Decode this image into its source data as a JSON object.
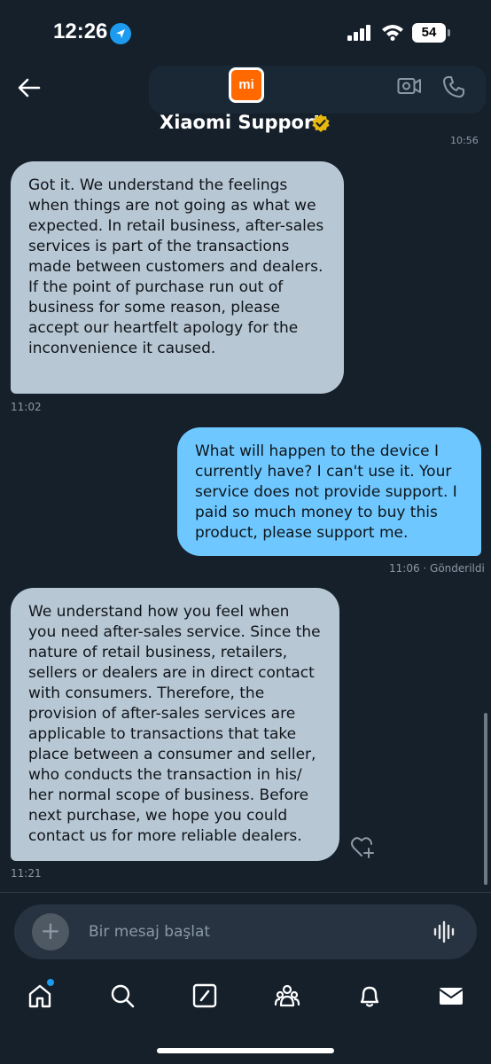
{
  "status_bar": {
    "time": "12:26",
    "battery": "54",
    "icons": [
      "location-icon",
      "signal-icon",
      "wifi-icon",
      "battery-icon"
    ]
  },
  "header": {
    "title": "Xiaomi Support",
    "avatar_text": "mi",
    "icons": [
      "back-arrow-icon",
      "verified-badge-icon",
      "video-call-icon",
      "phone-icon"
    ],
    "colors": {
      "avatar_bg": "#ff6900",
      "verified": "#e8b80c"
    }
  },
  "messages": [
    {
      "direction": "received",
      "text": "Got it. We understand the feelings when things are not going as what we expected. In retail business, after-sales services is part of the transactions made between customers and dealers. If the point of purchase run out of business for some reason, please accept our heartfelt apology for the inconvenience it caused.",
      "time": "11:02"
    },
    {
      "direction": "sent",
      "text": "What will happen to the device I currently have? I can't use it. Your service does not provide support. I paid so much money to buy this product, please support me.",
      "time": "11:06 · Gönderildi"
    },
    {
      "direction": "received",
      "text": "We understand how you feel when you need after-sales service. Since the nature of retail business, retailers, sellers or dealers are in direct contact with consumers. Therefore, the provision of after-sales services are applicable to transactions that take place between a consumer and seller, who conducts the transaction in his/ her normal scope of business. Before next purchase, we hope you could contact us for more reliable dealers.",
      "time": "11:21"
    }
  ],
  "composer": {
    "placeholder": "Bir mesaj başlat"
  },
  "tabbar": {
    "items": [
      "home-icon",
      "search-icon",
      "compose-icon",
      "communities-icon",
      "notifications-icon",
      "messages-icon"
    ]
  },
  "colors": {
    "background": "#15202b",
    "received_bubble": "#b8c7d4",
    "sent_bubble": "#6ec8ff",
    "accent": "#1d9bf0"
  }
}
